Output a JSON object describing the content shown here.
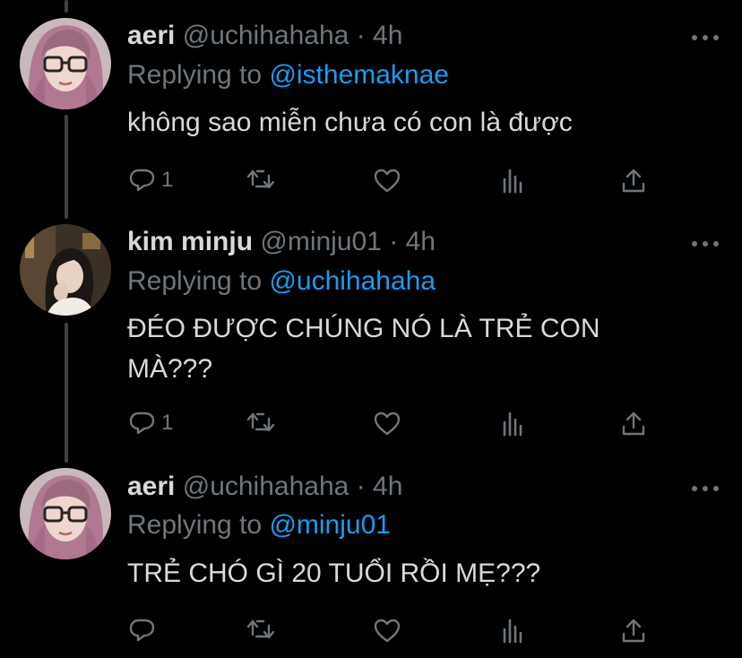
{
  "tweets": [
    {
      "name": "aeri",
      "handle": "@uchihahaha",
      "separator": "·",
      "time": "4h",
      "replying_label": "Replying to",
      "replying_to": "@isthemaknae",
      "text": "không sao miễn chưa có con là được",
      "reply_count": "1",
      "avatar": "pink-hair-glasses-avatar"
    },
    {
      "name": "kim minju",
      "handle": "@minju01",
      "separator": "·",
      "time": "4h",
      "replying_label": "Replying to",
      "replying_to": "@uchihahaha",
      "text": "ĐÉO ĐƯỢC CHÚNG NÓ LÀ TRẺ CON MÀ???",
      "reply_count": "1",
      "avatar": "dark-hair-photo-avatar"
    },
    {
      "name": "aeri",
      "handle": "@uchihahaha",
      "separator": "·",
      "time": "4h",
      "replying_label": "Replying to",
      "replying_to": "@minju01",
      "text": "TRẺ CHÓ GÌ 20 TUỔI RỒI MẸ???",
      "reply_count": "",
      "avatar": "pink-hair-glasses-avatar"
    }
  ],
  "colors": {
    "background": "#000000",
    "text": "#d9d9d9",
    "muted": "#6e767d",
    "accent": "#1d9bf0",
    "thread_line": "#3d4145"
  },
  "icons": [
    "reply-icon",
    "retweet-icon",
    "like-icon",
    "analytics-icon",
    "share-icon",
    "more-icon"
  ]
}
